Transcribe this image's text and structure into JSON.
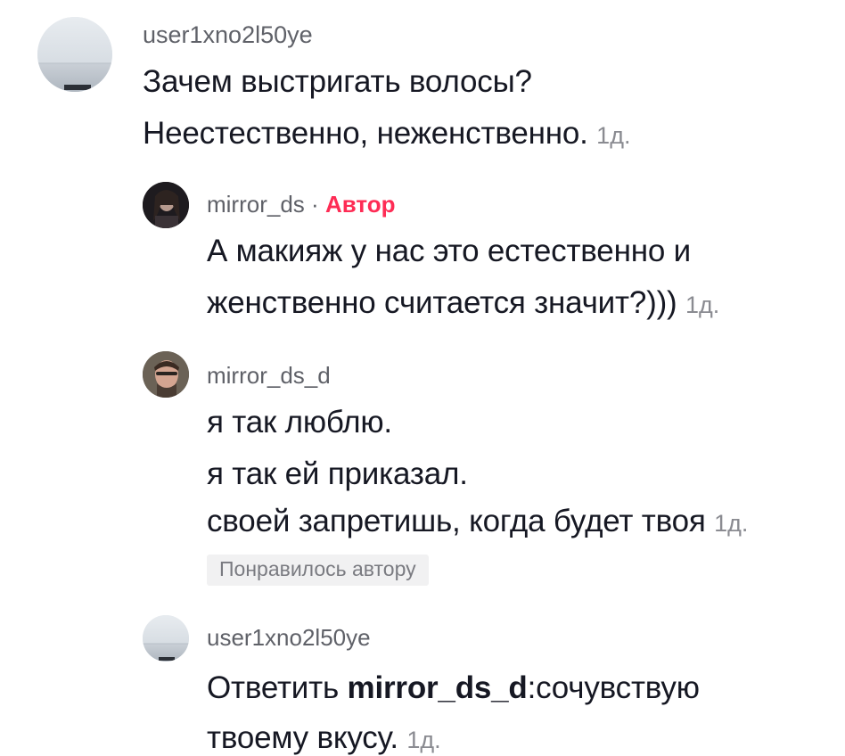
{
  "comments": [
    {
      "username": "user1xno2l50ye",
      "lines": [
        "Зачем выстригать волосы?",
        "Неестественно, неженственно."
      ],
      "time": "1д."
    },
    {
      "username": "mirror_ds",
      "separator": "·",
      "badge": "Автор",
      "lines": [
        "А макияж у нас это естественно и",
        "женственно считается значит?)))"
      ],
      "time": "1д."
    },
    {
      "username": "mirror_ds_d",
      "lines": [
        "я так люблю.",
        "я так ей приказал.",
        "своей запретишь, когда будет твоя"
      ],
      "time": "1д.",
      "liked_by_author": "Понравилось автору"
    },
    {
      "username": "user1xno2l50ye",
      "reply_prefix": "Ответить",
      "mention": "mirror_ds_d",
      "lines": [
        ":сочувствую",
        "твоему вкусу."
      ],
      "time": "1д."
    }
  ],
  "colors": {
    "text": "#161823",
    "username": "#5f6168",
    "time": "#8a8b91",
    "author_badge": "#fe2c55",
    "chip_bg": "#f1f1f2"
  }
}
